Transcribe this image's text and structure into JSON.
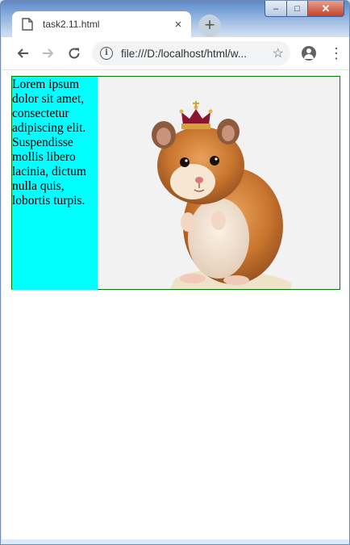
{
  "browser": {
    "tab_title": "task2.11.html",
    "new_tab_symbol": "+",
    "close_tab_symbol": "×",
    "url": "file:///D:/localhost/html/w...",
    "window_controls": {
      "minimize": "–",
      "maximize": "□",
      "close": "✕"
    }
  },
  "content": {
    "paragraph": "Lorem ipsum dolor sit amet, consectetur adipiscing elit. Suspendisse mollis libero lacinia, dictum nulla quis, lobortis turpis.",
    "image_subject": "hamster-with-crown"
  },
  "colors": {
    "text_background": "#00ffff",
    "container_border": "#008000"
  },
  "icons": [
    "page-icon",
    "back-arrow-icon",
    "forward-arrow-icon",
    "reload-icon",
    "info-icon",
    "star-icon",
    "account-icon",
    "menu-dots-icon"
  ]
}
